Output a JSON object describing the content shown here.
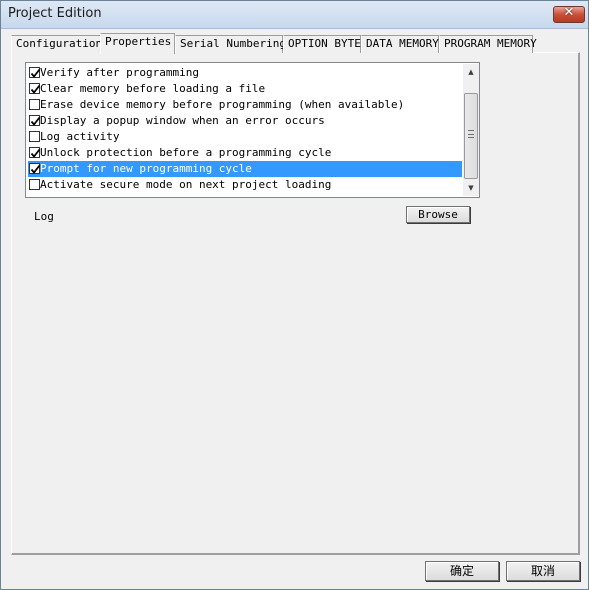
{
  "window": {
    "title": "Project Edition"
  },
  "tabs": [
    {
      "label": "Configuration",
      "active": false
    },
    {
      "label": "Properties",
      "active": true
    },
    {
      "label": "Serial Numbering",
      "active": false
    },
    {
      "label": "OPTION BYTE",
      "active": false
    },
    {
      "label": "DATA MEMORY",
      "active": false
    },
    {
      "label": "PROGRAM MEMORY",
      "active": false
    }
  ],
  "options": [
    {
      "label": "Verify after programming",
      "checked": true,
      "selected": false
    },
    {
      "label": "Clear memory before loading a file",
      "checked": true,
      "selected": false
    },
    {
      "label": "Erase device memory before programming (when available)",
      "checked": false,
      "selected": false
    },
    {
      "label": "Display a popup window when an error occurs",
      "checked": true,
      "selected": false
    },
    {
      "label": "Log activity",
      "checked": false,
      "selected": false
    },
    {
      "label": "Unlock protection before a programming cycle",
      "checked": true,
      "selected": false
    },
    {
      "label": "Prompt for new programming cycle",
      "checked": true,
      "selected": true
    },
    {
      "label": "Activate secure mode on next project loading",
      "checked": false,
      "selected": false
    }
  ],
  "log": {
    "label": "Log",
    "browse_label": "Browse"
  },
  "footer": {
    "ok_label": "确定",
    "cancel_label": "取消"
  },
  "colors": {
    "selection": "#3399ff",
    "title_gradient_top": "#dfe9f5",
    "close_button": "#c9503b"
  }
}
